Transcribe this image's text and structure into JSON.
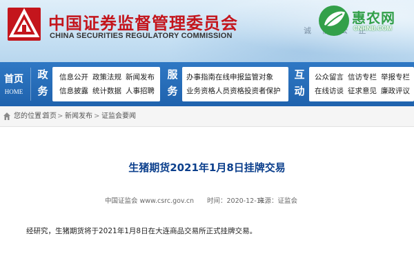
{
  "header": {
    "org_name_cn": "中国证券监督管理委员会",
    "org_name_en": "CHINA SECURITIES REGULATORY COMMISSION",
    "slogan": "诚 信 公 正",
    "brand_red": "#c4151c",
    "watermark": {
      "name_cn": "惠农网",
      "name_en": "CNHNB.COM",
      "icon": "leaf-logo-icon",
      "color": "#33a04a"
    }
  },
  "nav": {
    "home": {
      "label_cn": "首页",
      "label_en": "HOME"
    },
    "sections": [
      {
        "label": "政务",
        "links": [
          "信息公开",
          "政策法规",
          "新闻发布",
          "信息披露",
          "统计数据",
          "人事招聘"
        ]
      },
      {
        "label": "服务",
        "links": [
          "办事指南在线申报监管对象",
          "业务资格人员资格投资者保护"
        ]
      },
      {
        "label": "互动",
        "links": [
          "公众留言",
          "信访专栏",
          "举报专栏",
          "在线访谈",
          "征求意见",
          "廉政评议"
        ]
      }
    ],
    "bar_color": "#2f78c4"
  },
  "breadcrumb": {
    "icon": "home-icon",
    "items": [
      "您的位置：",
      "首页",
      "新闻发布",
      "证监会要闻"
    ],
    "separator": ">"
  },
  "article": {
    "title": "生猪期货2021年1月8日挂牌交易",
    "title_color": "#0b3f8c",
    "source": "中国证监会 www.csrc.gov.cn",
    "time": "时间：2020-12-11",
    "origin": "来源：证监会",
    "body": "经研究，生猪期货将于2021年1月8日在大连商品交易所正式挂牌交易。"
  }
}
